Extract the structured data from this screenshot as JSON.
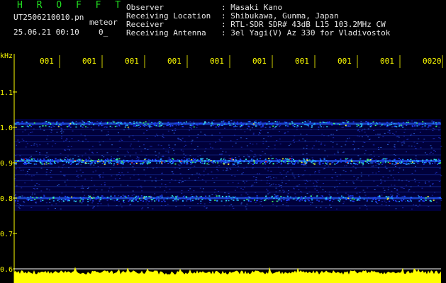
{
  "header": {
    "brand": "H R O F F T",
    "filename": "UT2506210010.pn",
    "mode": "meteor",
    "datetime": "25.06.21 00:10",
    "count": "0_",
    "fields": [
      {
        "label": "Observer",
        "value": ": Masaki Kano"
      },
      {
        "label": "Receiving Location",
        "value": ": Shibukawa, Gunma, Japan"
      },
      {
        "label": "Receiver",
        "value": ": RTL-SDR SDR# 43dB L15 103.2MHz CW"
      },
      {
        "label": "Receiving Antenna",
        "value": ": 3el Yagi(V) Az 330 for Vladivostok"
      }
    ]
  },
  "chart_data": {
    "type": "heatmap",
    "ylabel": "kHz",
    "yticks": [
      "1.1",
      "1.0",
      "0.9",
      "0.8",
      "0.7",
      "0.6"
    ],
    "ylim": [
      0.6,
      1.2
    ],
    "xticks": [
      "001",
      "001",
      "001",
      "001",
      "001",
      "001",
      "001",
      "001",
      "001",
      "0020"
    ],
    "bands_khz": [
      1.01,
      0.905,
      0.8
    ],
    "colors": {
      "axis": "#ffff00",
      "signal_low": "#1010c0",
      "signal_high": "#ff2020",
      "level": "#ffff00"
    }
  }
}
